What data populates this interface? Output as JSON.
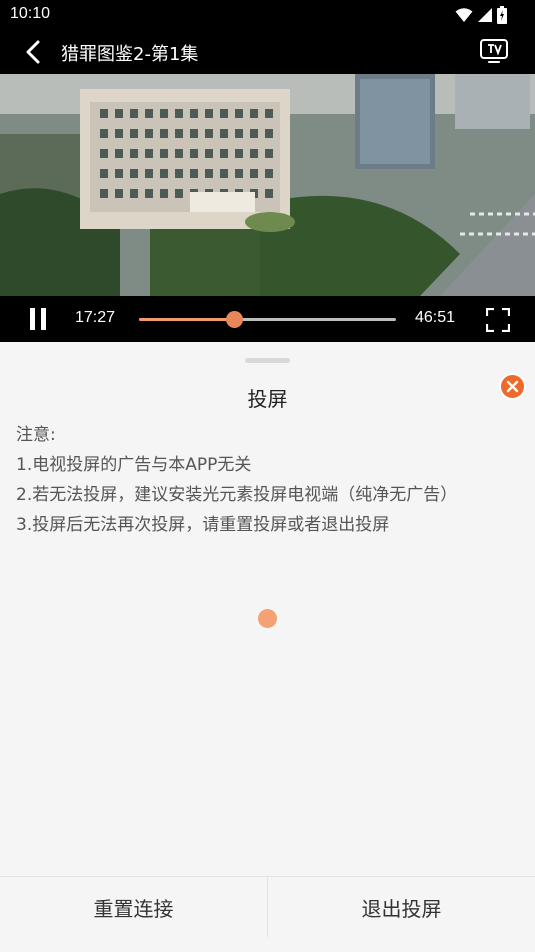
{
  "status_bar": {
    "time": "10:10"
  },
  "header": {
    "title": "猎罪图鉴2-第1集"
  },
  "player": {
    "current_time": "17:27",
    "duration": "46:51",
    "progress_fraction": 0.37,
    "accent_color": "#e8875a"
  },
  "cast_sheet": {
    "title": "投屏",
    "notes": [
      "注意:",
      "1.电视投屏的广告与本APP无关",
      "2.若无法投屏，建议安装光元素投屏电视端（纯净无广告）",
      "3.投屏后无法再次投屏，请重置投屏或者退出投屏"
    ],
    "close_color": "#ee6a2a"
  },
  "actions": {
    "reset_label": "重置连接",
    "exit_label": "退出投屏"
  }
}
